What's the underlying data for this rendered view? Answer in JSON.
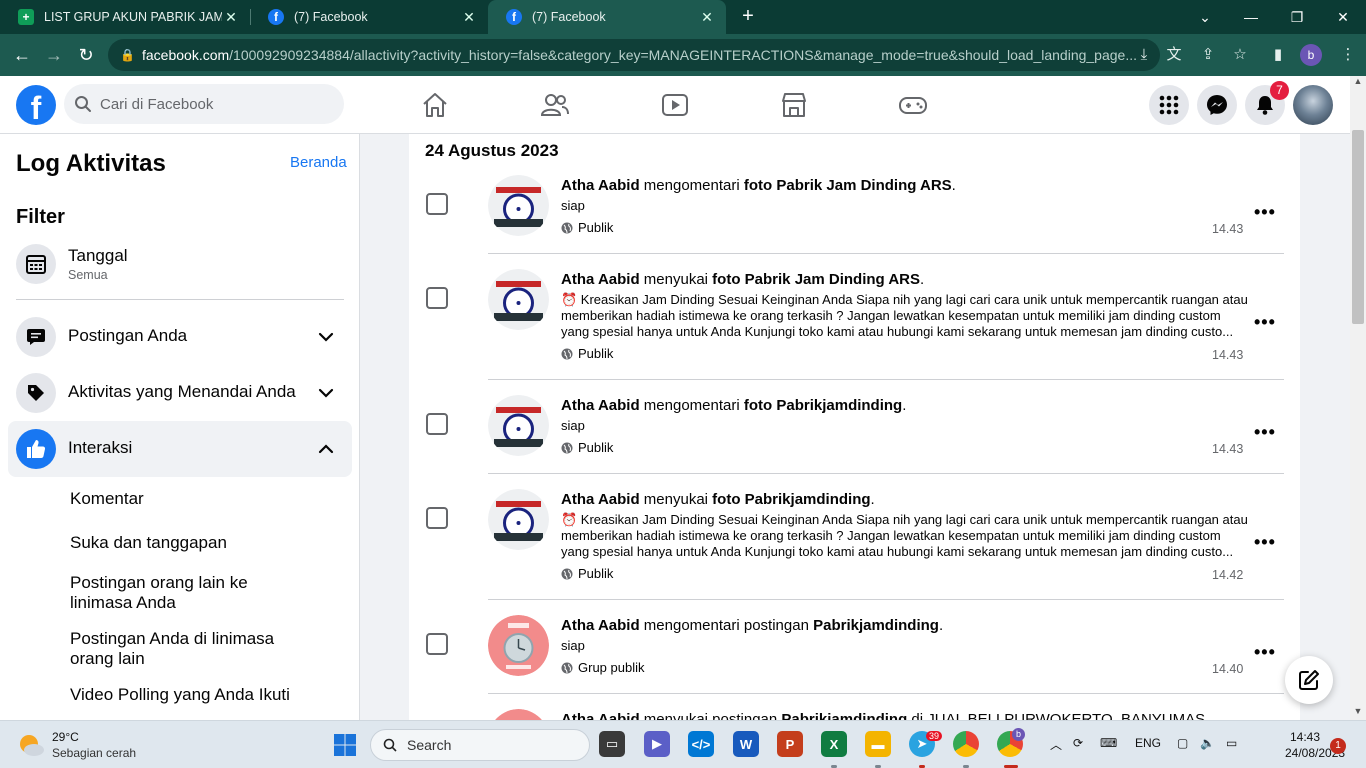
{
  "browser": {
    "tabs": [
      {
        "title": "LIST GRUP AKUN PABRIK JAM DI..."
      },
      {
        "title": "(7) Facebook"
      },
      {
        "title": "(7) Facebook"
      }
    ],
    "url_domain": "facebook.com",
    "url_rest": "/100092909234884/allactivity?activity_history=false&category_key=MANAGEINTERACTIONS&manage_mode=true&should_load_landing_page...",
    "profile_initial": "b"
  },
  "header": {
    "search_placeholder": "Cari di Facebook",
    "notification_count": "7"
  },
  "sidebar": {
    "title": "Log Aktivitas",
    "home_link": "Beranda",
    "filter_title": "Filter",
    "date_label": "Tanggal",
    "date_value": "Semua",
    "sections": [
      {
        "label": "Postingan Anda"
      },
      {
        "label": "Aktivitas yang Menandai Anda"
      },
      {
        "label": "Interaksi"
      }
    ],
    "sub_items": [
      {
        "label": "Komentar"
      },
      {
        "label": "Suka dan tanggapan"
      },
      {
        "label": "Postingan orang lain ke linimasa Anda"
      },
      {
        "label": "Postingan Anda di linimasa orang lain"
      },
      {
        "label": "Video Polling yang Anda Ikuti"
      }
    ]
  },
  "main": {
    "date_header": "24 Agustus 2023",
    "activities": [
      {
        "actor": "Atha Aabid",
        "verb": "mengomentari",
        "object_type": "foto",
        "target": "Pabrik Jam Dinding ARS",
        "suffix": ".",
        "text": "siap",
        "privacy": "Publik",
        "time": "14.43"
      },
      {
        "actor": "Atha Aabid",
        "verb": "menyukai",
        "object_type": "foto",
        "target": "Pabrik Jam Dinding ARS",
        "suffix": ".",
        "text": "⏰ Kreasikan Jam Dinding Sesuai Keinginan Anda Siapa nih yang lagi cari cara unik untuk mempercantik ruangan atau memberikan hadiah istimewa ke orang terkasih ? Jangan lewatkan kesempatan untuk memiliki jam dinding custom yang spesial hanya untuk Anda Kunjungi toko kami atau hubungi kami sekarang untuk memesan jam dinding custo...",
        "privacy": "Publik",
        "time": "14.43"
      },
      {
        "actor": "Atha Aabid",
        "verb": "mengomentari",
        "object_type": "foto",
        "target": "Pabrikjamdinding",
        "suffix": ".",
        "text": "siap",
        "privacy": "Publik",
        "time": "14.43"
      },
      {
        "actor": "Atha Aabid",
        "verb": "menyukai",
        "object_type": "foto",
        "target": "Pabrikjamdinding",
        "suffix": ".",
        "text": "⏰ Kreasikan Jam Dinding Sesuai Keinginan Anda Siapa nih yang lagi cari cara unik untuk mempercantik ruangan atau memberikan hadiah istimewa ke orang terkasih ? Jangan lewatkan kesempatan untuk memiliki jam dinding custom yang spesial hanya untuk Anda Kunjungi toko kami atau hubungi kami sekarang untuk memesan jam dinding custo...",
        "privacy": "Publik",
        "time": "14.42"
      },
      {
        "actor": "Atha Aabid",
        "verb": "mengomentari",
        "object_type": "postingan",
        "target": "Pabrikjamdinding",
        "suffix": ".",
        "text": "siap",
        "privacy": "Grup publik",
        "time": "14.40"
      },
      {
        "actor": "Atha Aabid",
        "verb": "menyukai",
        "object_type": "postingan",
        "target": "Pabrikjamdinding",
        "suffix": " di JUAL BELI PURWOKERTO, BANYUMAS",
        "text": "",
        "privacy": "",
        "time": ""
      }
    ]
  },
  "taskbar": {
    "weather_temp": "29°C",
    "weather_desc": "Sebagian cerah",
    "search_label": "Search",
    "telegram_badge": "39",
    "chrome_badge": "b",
    "lang": "ENG",
    "time": "14:43",
    "date": "24/08/2023",
    "notification_count": "1"
  },
  "colors": {
    "fb_blue": "#1877f2",
    "chrome_dark": "#0b3b34",
    "chrome_bar": "#1d5a50"
  }
}
